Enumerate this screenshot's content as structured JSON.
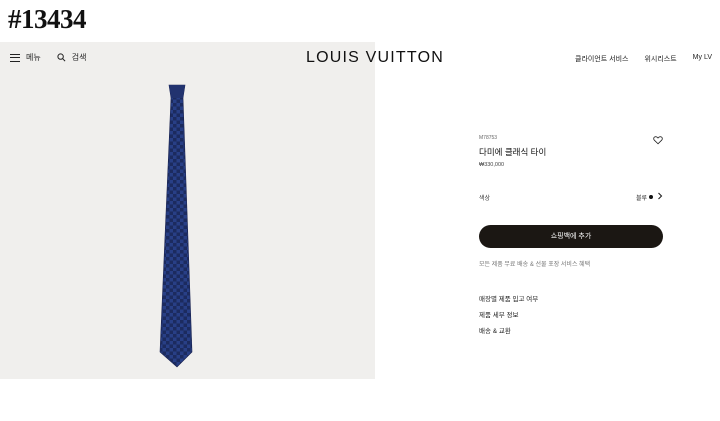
{
  "stamp": "#13434",
  "header": {
    "menu_label": "메뉴",
    "search_label": "검색",
    "brand": "LOUIS VUITTON",
    "right_items": [
      "클라이언트 서비스",
      "위시리스트",
      "My LV"
    ]
  },
  "product": {
    "sku": "M78753",
    "name": "다미에 클래식 타이",
    "price": "₩330,000",
    "color_label": "색상",
    "color_value": "블루",
    "color_swatch": "#111111",
    "add_to_cart": "쇼핑백에 추가",
    "shipping_note": "모든 제품 무료 배송 & 선물 포장 서비스 혜택",
    "links": [
      "매장별 제품 입고 여부",
      "제품 세부 정보",
      "배송 & 교환"
    ]
  },
  "colors": {
    "tie_base": "#283f86",
    "tie_check": "#1c2b5f",
    "button_bg": "#1b1713",
    "hero_bg": "#f0efed"
  }
}
